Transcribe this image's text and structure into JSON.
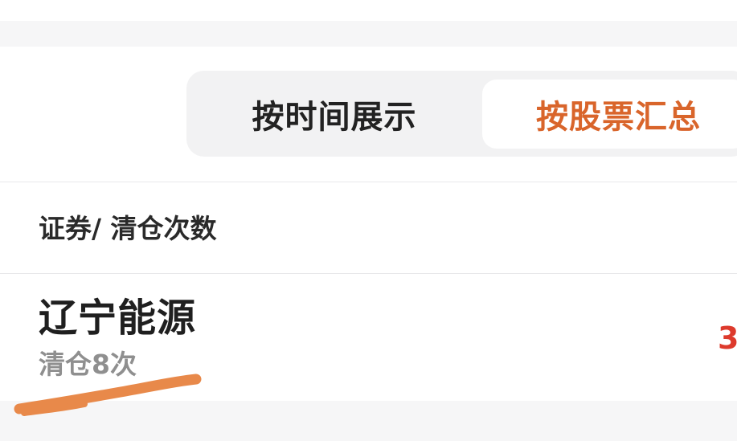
{
  "tabs": {
    "by_time": "按时间展示",
    "by_stock": "按股票汇总",
    "active": "by_stock"
  },
  "table": {
    "header": "证券/ 清仓次数",
    "rows": [
      {
        "name": "辽宁能源",
        "sub": "清仓8次",
        "right_value": "3"
      }
    ]
  },
  "colors": {
    "accent": "#d9652b",
    "value_red": "#dd3a2c",
    "annotation_stroke": "#e8894a"
  },
  "annotation": {
    "type": "hand-drawn-underline"
  }
}
